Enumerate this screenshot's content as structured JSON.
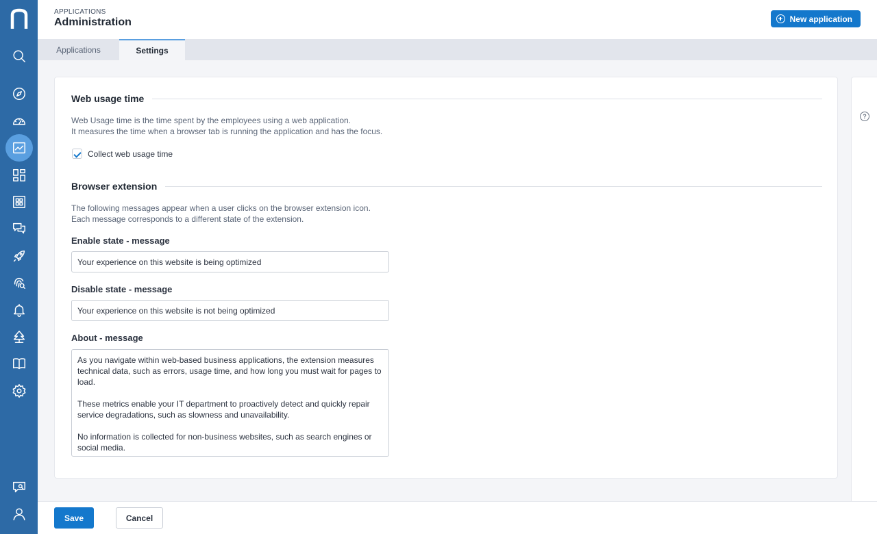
{
  "header": {
    "eyebrow": "APPLICATIONS",
    "title": "Administration",
    "new_button_label": "New application"
  },
  "tabs": [
    {
      "label": "Applications",
      "active": false
    },
    {
      "label": "Settings",
      "active": true
    }
  ],
  "sidebar": {
    "icons": [
      "logo",
      "search-icon",
      "compass-icon",
      "gauge-icon",
      "analytics-icon",
      "dashboard-icon",
      "apps-grid-icon",
      "chat-icon",
      "rocket-icon",
      "fingerprint-search-icon",
      "bell-icon",
      "tree-icon",
      "book-icon",
      "gear-icon",
      "feedback-search-icon",
      "user-icon"
    ],
    "active": "analytics-icon"
  },
  "web_usage": {
    "title": "Web usage time",
    "desc_line1": "Web Usage time is the time spent by the employees using a web application.",
    "desc_line2": "It measures the time when a browser tab is running the application and has the focus.",
    "checkbox_label": "Collect web usage time",
    "checked": true
  },
  "browser_extension": {
    "title": "Browser extension",
    "desc_line1": "The following messages appear when a user clicks on the browser extension icon.",
    "desc_line2": "Each message corresponds to a different state of the extension.",
    "enable_label": "Enable state - message",
    "enable_value": "Your experience on this website is being optimized",
    "disable_label": "Disable state - message",
    "disable_value": "Your experience on this website is not being optimized",
    "about_label": "About - message",
    "about_value": "As you navigate within web-based business applications, the extension measures technical data, such as errors, usage time, and how long you must wait for pages to load.\n\nThese metrics enable your IT department to proactively detect and quickly repair service degradations, such as slowness and unavailability.\n\nNo information is collected for non-business websites, such as search engines or social media."
  },
  "footer": {
    "save_label": "Save",
    "cancel_label": "Cancel"
  },
  "colors": {
    "sidebar": "#2d6aa6",
    "accent": "#1478cc",
    "active_nav": "#5a9fe0"
  }
}
